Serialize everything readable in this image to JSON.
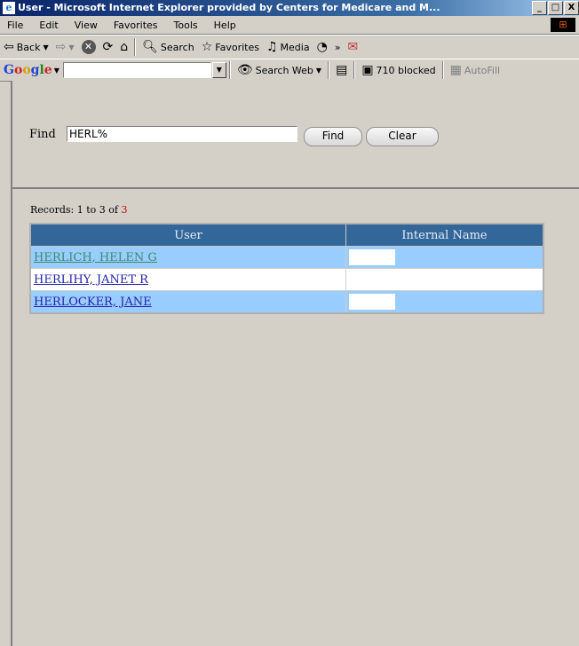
{
  "window": {
    "title": "User - Microsoft Internet Explorer provided by Centers for Medicare and M...",
    "buttons": [
      "_",
      "□",
      "X"
    ]
  },
  "menu": [
    "File",
    "Edit",
    "View",
    "Favorites",
    "Tools",
    "Help"
  ],
  "toolbar": {
    "back_label": "Back",
    "search_label": "Search",
    "favorites_label": "Favorites",
    "media_label": "Media"
  },
  "google_bar": {
    "logo": "Google",
    "search_value": "",
    "search_web_label": "Search Web",
    "blocked_label": "710 blocked",
    "autofill_label": "AutoFill"
  },
  "find": {
    "label": "Find",
    "value": "HERL%",
    "find_button": "Find",
    "clear_button": "Clear"
  },
  "records": {
    "prefix": "Records: 1 to 3 of ",
    "total": "3"
  },
  "table": {
    "headers": [
      "User",
      "Internal Name"
    ],
    "rows": [
      {
        "user": "HERLICH, HELEN G",
        "internal_name": ""
      },
      {
        "user": "HERLIHY, JANET R",
        "internal_name": ""
      },
      {
        "user": "HERLOCKER, JANE",
        "internal_name": ""
      }
    ]
  },
  "colors": {
    "table_header_bg": "#336699",
    "row_alt_bg": "#99ccff",
    "link": "#2222aa",
    "visited_link": "#3a8a6a",
    "record_total": "#cc0000"
  }
}
